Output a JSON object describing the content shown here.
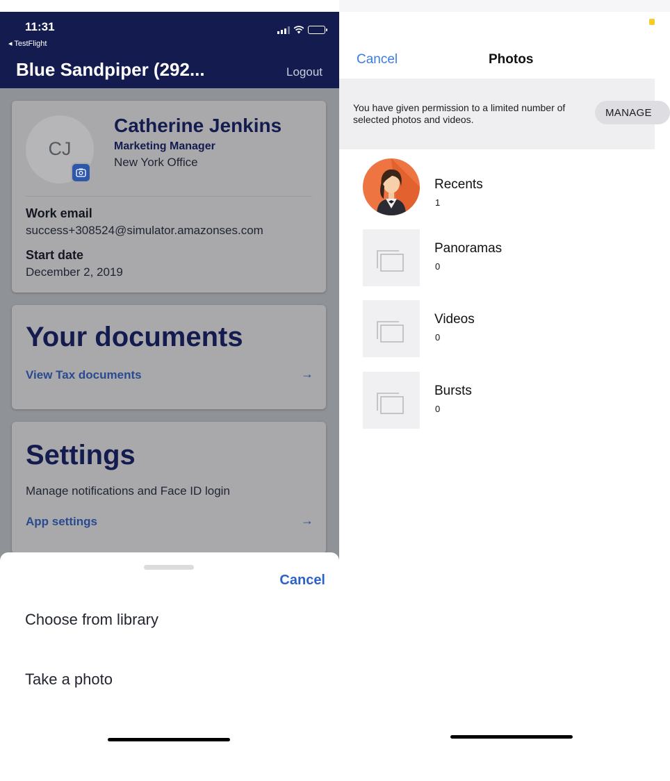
{
  "left_phone": {
    "status_bar": {
      "time": "11:31",
      "back_app": "◂ TestFlight"
    },
    "app_bar": {
      "title": "Blue Sandpiper (292...",
      "logout": "Logout"
    },
    "profile": {
      "initials": "CJ",
      "name": "Catherine Jenkins",
      "role": "Marketing Manager",
      "office": "New York Office",
      "work_email_label": "Work email",
      "work_email": "success+308524@simulator.amazonses.com",
      "start_date_label": "Start date",
      "start_date": "December 2, 2019"
    },
    "documents": {
      "title": "Your documents",
      "link": "View Tax documents",
      "arrow": "→"
    },
    "settings": {
      "title": "Settings",
      "description": "Manage notifications and Face ID login",
      "link": "App settings",
      "arrow": "→"
    },
    "action_sheet": {
      "cancel": "Cancel",
      "options": [
        "Choose from library",
        "Take a photo"
      ]
    }
  },
  "right_phone": {
    "nav": {
      "cancel": "Cancel",
      "title": "Photos"
    },
    "banner": {
      "message": "You have given permission to a limited number of selected photos and videos.",
      "manage": "MANAGE"
    },
    "albums": [
      {
        "name": "Recents",
        "count": "1"
      },
      {
        "name": "Panoramas",
        "count": "0"
      },
      {
        "name": "Videos",
        "count": "0"
      },
      {
        "name": "Bursts",
        "count": "0"
      }
    ]
  },
  "colors": {
    "brand_navy": "#141c4f",
    "link_blue": "#2a4a8f",
    "ios_blue": "#3a7ce0",
    "battery_yellow": "#f5cc2c"
  }
}
